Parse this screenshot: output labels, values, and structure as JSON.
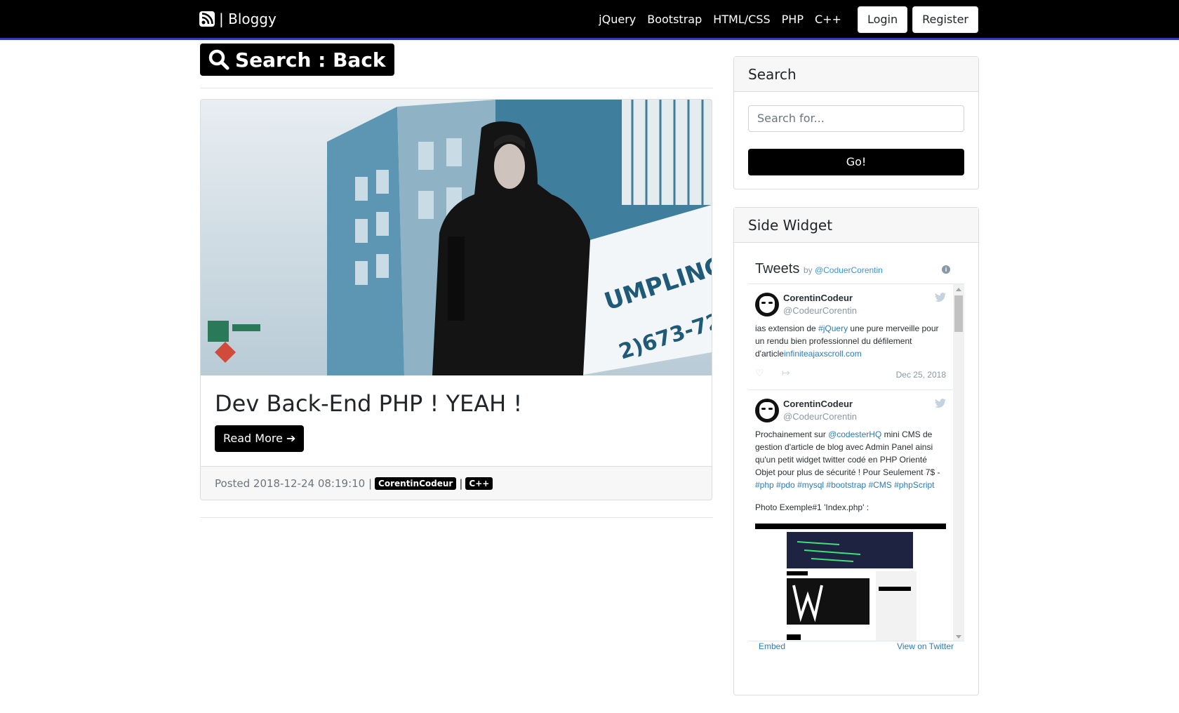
{
  "navbar": {
    "brand": "| Bloggy",
    "links": [
      "jQuery",
      "Bootstrap",
      "HTML/CSS",
      "PHP",
      "C++"
    ],
    "login": "Login",
    "register": "Register"
  },
  "search_heading": "Search : Back",
  "post": {
    "title": "Dev Back-End PHP ! YEAH !",
    "read_more": "Read More",
    "posted": "Posted 2018-12-24 08:19:10 |",
    "author_badge": "CorentinCodeur",
    "separator": "|",
    "tag_badge": "C++"
  },
  "sidebar": {
    "search": {
      "title": "Search",
      "placeholder": "Search for...",
      "button": "Go!"
    },
    "side_widget": {
      "title": "Side Widget",
      "twitter": {
        "heading": "Tweets",
        "by": "by",
        "by_handle": "@CoduerCorentin",
        "tweets": [
          {
            "name": "CorentinCodeur",
            "handle": "@CodeurCorentin",
            "text_pre": "ias extension de ",
            "hashtag": "#jQuery",
            "text_post": " une pure merveille pour un rendu bien professionnel du défilement d'article",
            "link": "infiniteajaxscroll.com",
            "date": "Dec 25, 2018"
          },
          {
            "name": "CorentinCodeur",
            "handle": "@CodeurCorentin",
            "text_pre": "Prochainement sur ",
            "mention": "@codesterHQ",
            "text_post": " mini CMS de gestion d'article de blog avec Admin Panel ainsi qu'un petit widget twitter codé en PHP Orienté Objet pour plus de sécurité ! Pour Seulement 7$ -",
            "hashtags": "#php #pdo #mysql #bootstrap #CMS #phpScript",
            "photo_caption": "Photo Exemple#1  'Index.php' :"
          }
        ],
        "embed": "Embed",
        "view_on_twitter": "View on Twitter"
      }
    }
  }
}
